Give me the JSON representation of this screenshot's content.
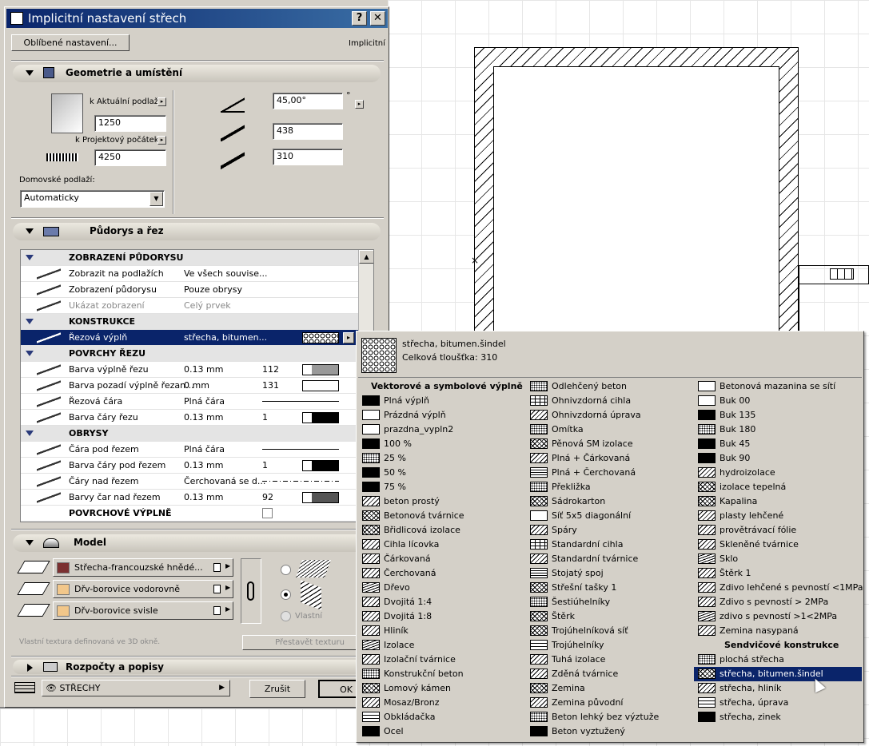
{
  "dialog": {
    "title": "Implicitní nastavení střech",
    "help_label": "?",
    "close_label": "✕",
    "favorites_label": "Oblíbené nastavení...",
    "mode_label": "Implicitní"
  },
  "geometry": {
    "header": "Geometrie a umístění",
    "current_floor_label": "k Aktuální podlaží",
    "current_floor_value": "1250",
    "project_zero_label": "k Projektový počátek",
    "project_zero_value": "4250",
    "angle_value": "45,00°",
    "angle_unit": "°",
    "thickness1_value": "438",
    "thickness2_value": "310",
    "home_story_label": "Domovské podlaží:",
    "home_story_value": "Automaticky"
  },
  "plan": {
    "header": "Půdorys a řez",
    "rows": [
      {
        "type": "group",
        "name": "ZOBRAZENÍ PŮDORYSU"
      },
      {
        "type": "row",
        "name": "Zobrazit na podlažích",
        "value": "Ve všech souvise..."
      },
      {
        "type": "row",
        "name": "Zobrazení půdorysu",
        "value": "Pouze obrysy"
      },
      {
        "type": "row",
        "name": "Ukázat zobrazení",
        "value": "Celý prvek",
        "dim": true
      },
      {
        "type": "group",
        "name": "KONSTRUKCE"
      },
      {
        "type": "row",
        "name": "Řezová výplň",
        "value": "střecha, bitumen...",
        "selected": true
      },
      {
        "type": "group",
        "name": "POVRCHY ŘEZU"
      },
      {
        "type": "row",
        "name": "Barva výplně řezu",
        "value": "0.13 mm",
        "num": "112"
      },
      {
        "type": "row",
        "name": "Barva pozadí výplně řezan...",
        "value": "0 mm",
        "num": "131"
      },
      {
        "type": "row",
        "name": "Řezová čára",
        "value": "Plná čára"
      },
      {
        "type": "row",
        "name": "Barva čáry řezu",
        "value": "0.13 mm",
        "num": "1"
      },
      {
        "type": "group",
        "name": "OBRYSY"
      },
      {
        "type": "row",
        "name": "Čára pod řezem",
        "value": "Plná čára"
      },
      {
        "type": "row",
        "name": "Barva čáry pod řezem",
        "value": "0.13 mm",
        "num": "1"
      },
      {
        "type": "row",
        "name": "Čáry nad řezem",
        "value": "Čerchovaná se d..."
      },
      {
        "type": "row",
        "name": "Barvy čar nad řezem",
        "value": "0.13 mm",
        "num": "92"
      },
      {
        "type": "plain",
        "name": "POVRCHOVÉ VÝPLNĚ"
      }
    ]
  },
  "model": {
    "header": "Model",
    "materials": [
      {
        "name": "Střecha-francouzské hnědé...",
        "color": "#7b3030"
      },
      {
        "name": "Dřv-borovice vodorovně",
        "color": "#f2c78a"
      },
      {
        "name": "Dřv-borovice svisle",
        "color": "#f2c78a"
      }
    ],
    "custom_label": "Vlastní",
    "texture_note": "Vlastní textura definovaná ve 3D okně.",
    "rebuild_label": "Přestavět texturu"
  },
  "listing": {
    "header": "Rozpočty a popisy"
  },
  "footer": {
    "layer_label": "STŘECHY",
    "cancel_label": "Zrušit",
    "ok_label": "OK"
  },
  "popup": {
    "preview_name": "střecha, bitumen.šindel",
    "preview_thickness": "Celková tloušťka: 310",
    "col1_header": "Vektorové a symbolové výplně",
    "col1": [
      "Plná výplň",
      "Prázdná výplň",
      "prazdna_vypln2",
      "100 %",
      "25 %",
      "50 %",
      "75 %",
      "beton prostý",
      "Betonová tvárnice",
      "Břidlicová izolace",
      "Cihla lícovka",
      "Čárkovaná",
      "Čerchovaná",
      "Dřevo",
      "Dvojitá 1:4",
      "Dvojitá 1:8",
      "Hliník",
      "Izolace",
      "Izolační tvárnice",
      "Konstrukční beton",
      "Lomový kámen",
      "Mosaz/Bronz",
      "Obkládačka",
      "Ocel"
    ],
    "col2": [
      "Odlehčený beton",
      "Ohnivzdorná cihla",
      "Ohnivzdorná úprava",
      "Omítka",
      "Pěnová SM izolace",
      "Plná + Čárkovaná",
      "Plná + Čerchovaná",
      "Překližka",
      "Sádrokarton",
      "Síť 5x5 diagonální",
      "Spáry",
      "Standardní cihla",
      "Standardní tvárnice",
      "Stojatý spoj",
      "Střešní tašky 1",
      "Šestiúhelníky",
      "Štěrk",
      "Trojúhelníková síť",
      "Trojúhelníky",
      "Tuhá izolace",
      "Zděná tvárnice",
      "Zemina",
      "Zemina původní",
      "Beton lehký bez výztuže",
      "Beton vyztužený"
    ],
    "col3": [
      "Betonová mazanina se sítí",
      "Buk 00",
      "Buk 135",
      "Buk 180",
      "Buk 45",
      "Buk 90",
      "hydroizolace",
      "izolace tepelná",
      "Kapalina",
      "plasty lehčené",
      "provětrávací fólie",
      "Skleněné tvárnice",
      "Sklo",
      "Štěrk 1",
      "Zdivo lehčené s pevností <1MPa",
      "Zdivo s pevností > 2MPa",
      "zdivo s pevností >1<2MPa",
      "Zemina nasypaná"
    ],
    "col3_header": "Sendvičové konstrukce",
    "col3b": [
      "plochá střecha",
      "střecha, bitumen.šindel",
      "střecha, hliník",
      "střecha, úprava",
      "střecha, zinek"
    ],
    "selected": "střecha, bitumen.šindel"
  }
}
